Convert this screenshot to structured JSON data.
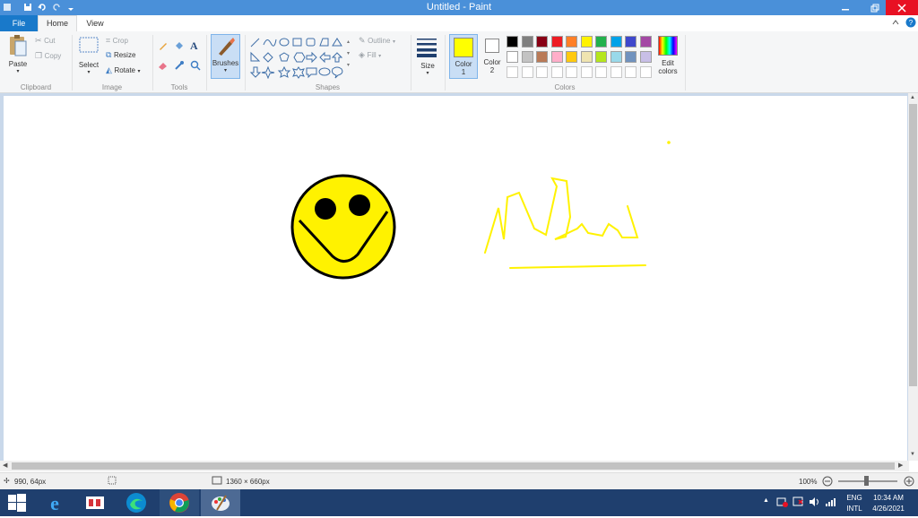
{
  "window": {
    "title": "Untitled - Paint"
  },
  "tabs": {
    "file": "File",
    "home": "Home",
    "view": "View"
  },
  "ribbon": {
    "clipboard": {
      "paste": "Paste",
      "cut": "Cut",
      "copy": "Copy",
      "group": "Clipboard"
    },
    "image": {
      "select": "Select",
      "crop": "Crop",
      "resize": "Resize",
      "rotate": "Rotate",
      "group": "Image"
    },
    "tools": {
      "group": "Tools"
    },
    "brushes": {
      "label": "Brushes"
    },
    "shapes": {
      "outline": "Outline",
      "fill": "Fill",
      "group": "Shapes"
    },
    "size": {
      "label": "Size"
    },
    "colors": {
      "color1_label": "Color",
      "color1_num": "1",
      "color2_label": "Color",
      "color2_num": "2",
      "edit_label_1": "Edit",
      "edit_label_2": "colors",
      "group": "Colors",
      "color1": "#ffff00",
      "color2": "#ffffff",
      "palette_row1": [
        "#000000",
        "#7f7f7f",
        "#880015",
        "#ed1c24",
        "#ff7f27",
        "#fff200",
        "#22b14c",
        "#00a2e8",
        "#3f48cc",
        "#a349a4"
      ],
      "palette_row2": [
        "#ffffff",
        "#c3c3c3",
        "#b97a57",
        "#ffaec9",
        "#ffc90e",
        "#efe4b0",
        "#b5e61d",
        "#99d9ea",
        "#7092be",
        "#c8bfe7"
      ],
      "palette_row3": [
        "#ffffff",
        "#ffffff",
        "#ffffff",
        "#ffffff",
        "#ffffff",
        "#ffffff",
        "#ffffff",
        "#ffffff",
        "#ffffff",
        "#ffffff"
      ]
    }
  },
  "status": {
    "cursor_pos": "990, 64px",
    "image_size": "1360 × 660px",
    "zoom": "100%"
  },
  "tray": {
    "lang_1": "ENG",
    "lang_2": "INTL",
    "time": "10:34 AM",
    "date": "4/26/2021"
  }
}
